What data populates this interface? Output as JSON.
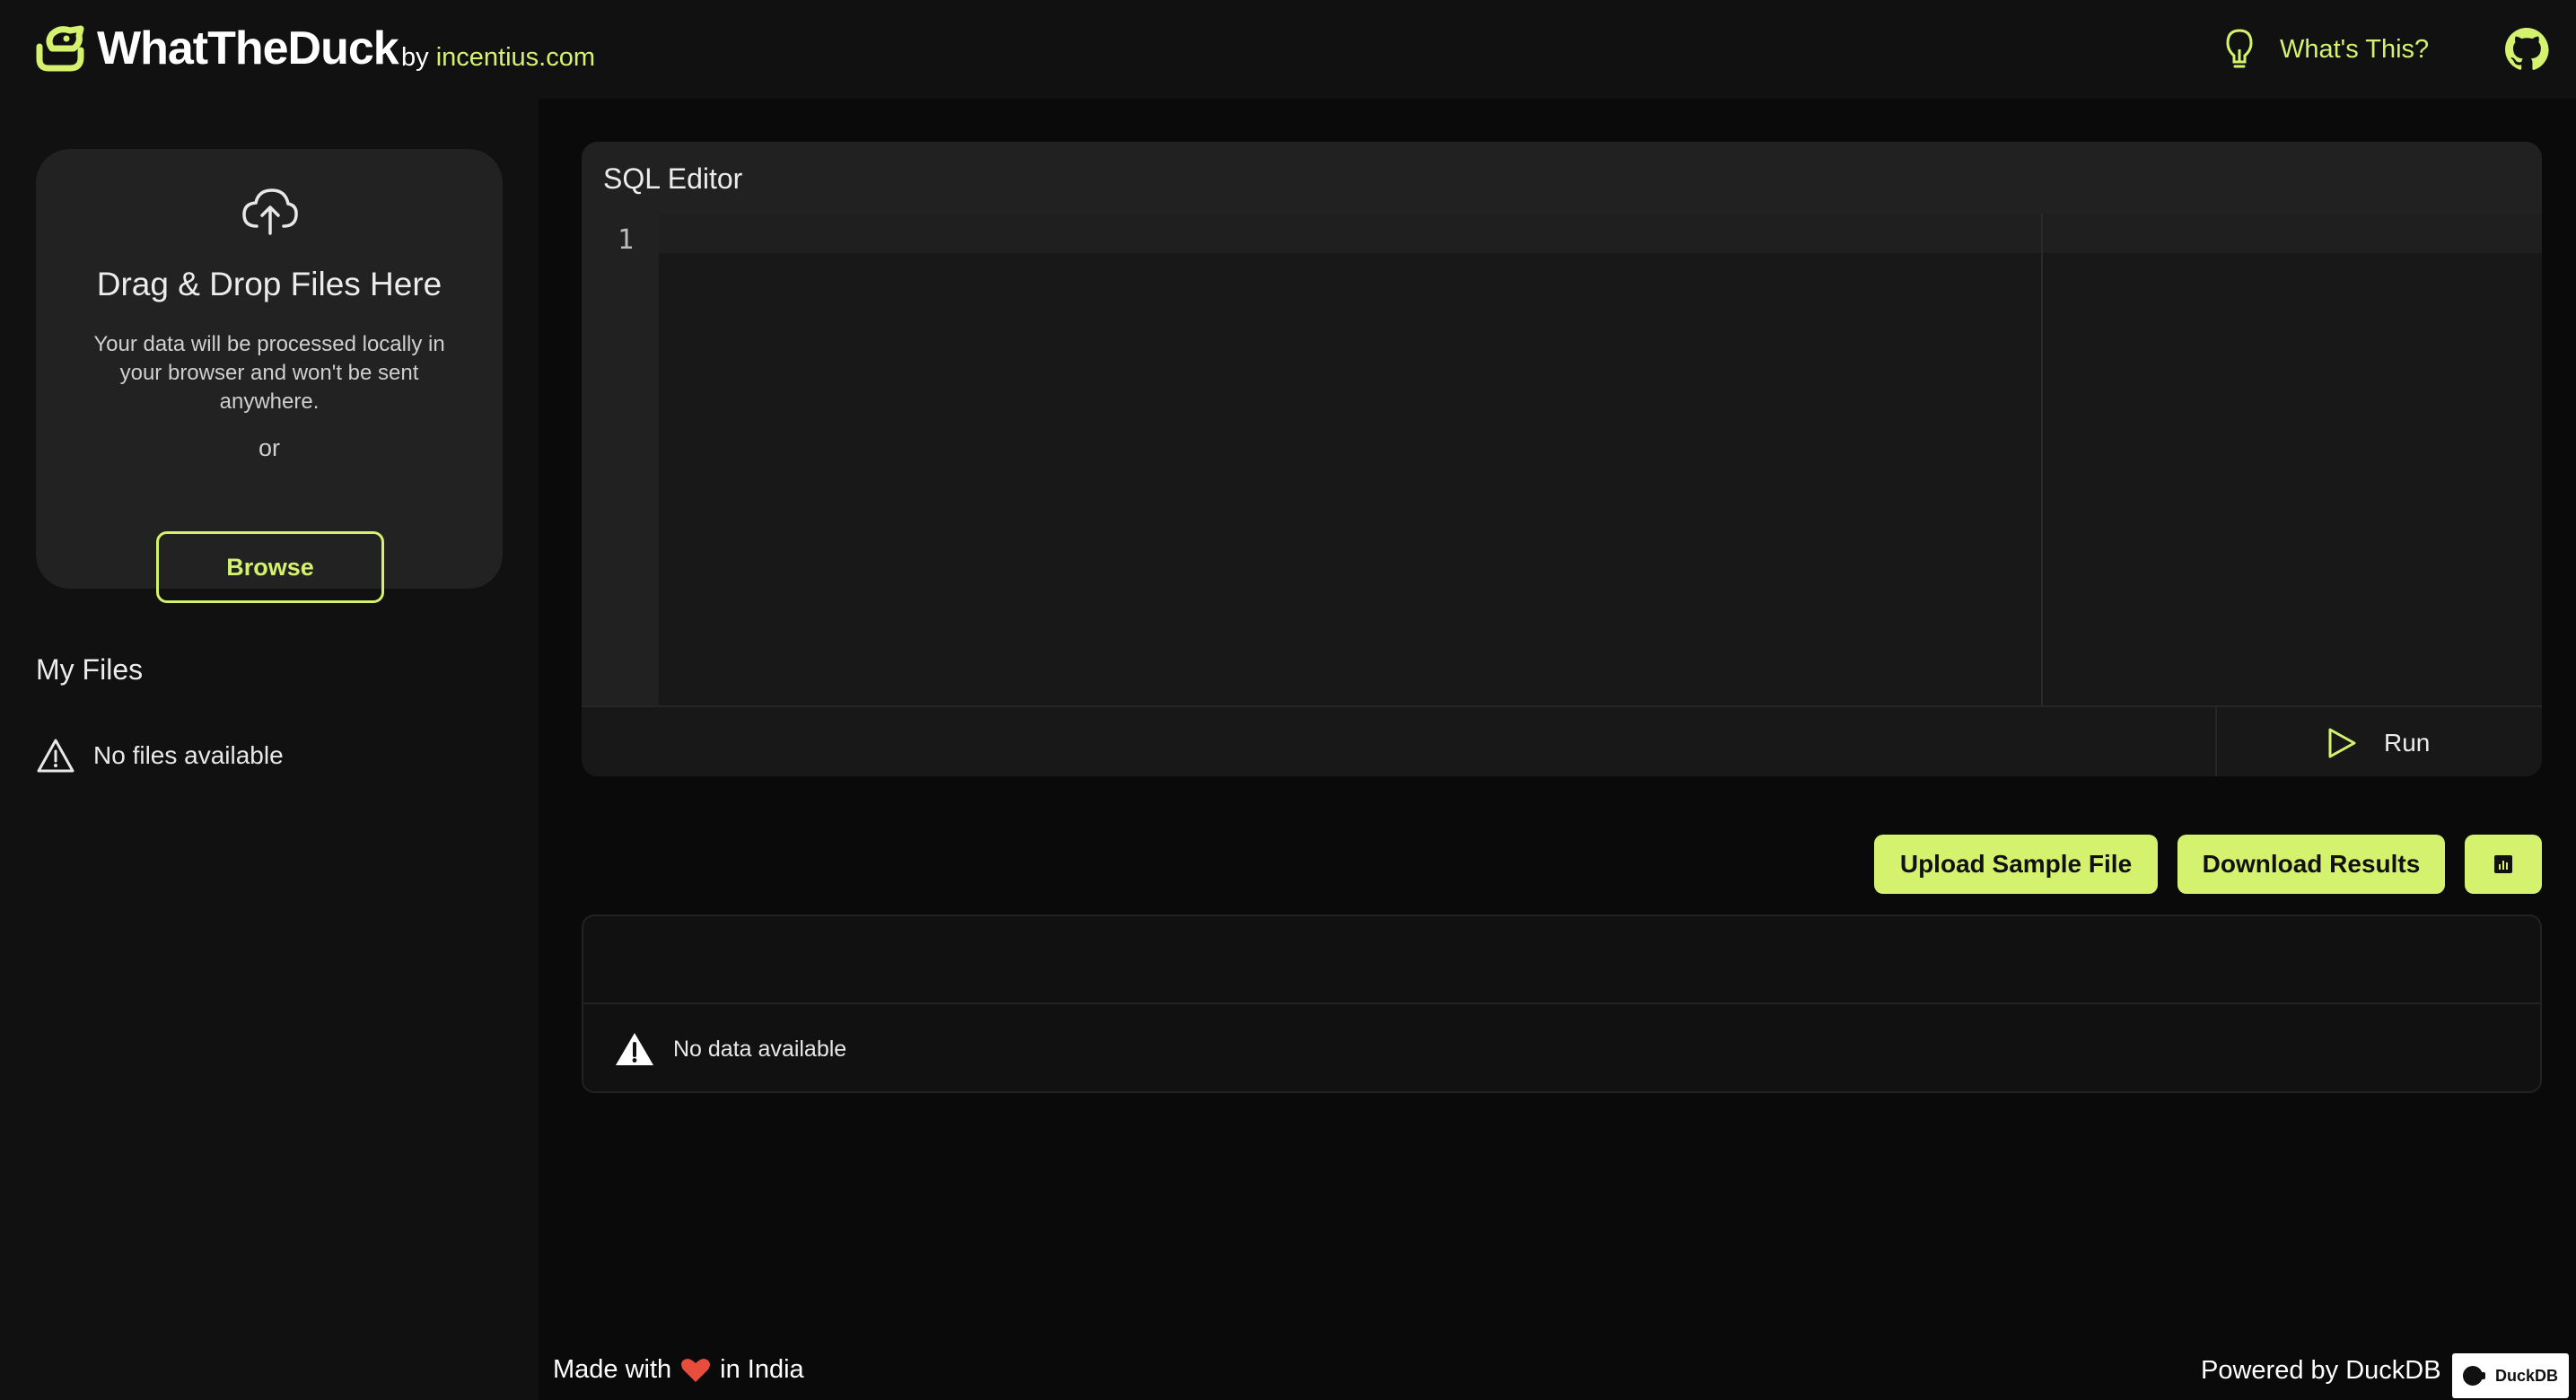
{
  "header": {
    "logo_text": "WhatTheDuck",
    "by_prefix": "by",
    "by_link": "incentius.com",
    "whats_this": "What's This?",
    "lightbulb_icon": "lightbulb-icon",
    "github_icon": "github-icon"
  },
  "sidebar": {
    "drop_title": "Drag & Drop Files Here",
    "drop_description": "Your data will be processed locally in your browser and won't be sent anywhere.",
    "or_text": "or",
    "browse_label": "Browse",
    "upload_icon": "cloud-upload-icon",
    "my_files_title": "My Files",
    "no_files_text": "No files available"
  },
  "editor": {
    "title": "SQL Editor",
    "line_numbers": [
      "1"
    ],
    "run_label": "Run"
  },
  "actions": {
    "upload_sample": "Upload Sample File",
    "download_results": "Download Results",
    "chart_icon": "bar-chart-icon"
  },
  "results": {
    "no_data_text": "No data available"
  },
  "footer": {
    "made_with_prefix": "Made with",
    "made_with_suffix": "in India",
    "powered_by": "Powered by DuckDB",
    "badge_text": "DuckDB"
  },
  "colors": {
    "accent": "#d4f26e",
    "background": "#0a0a0a",
    "panel": "#111111",
    "card": "#222222",
    "heart": "#e74c3c"
  }
}
